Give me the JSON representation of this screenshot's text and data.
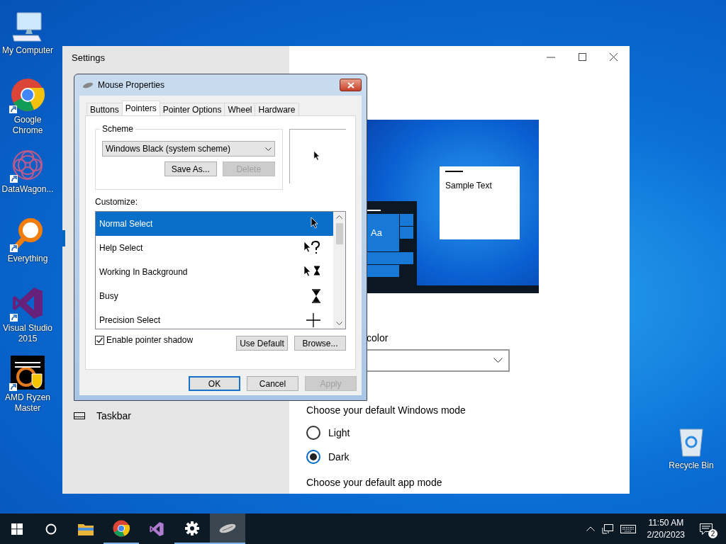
{
  "desktop_icons": [
    {
      "label": "My Computer",
      "kind": "computer",
      "shortcut": false
    },
    {
      "label": "Google Chrome",
      "kind": "chrome",
      "shortcut": true
    },
    {
      "label": "DataWagon...",
      "kind": "datawagon",
      "shortcut": true
    },
    {
      "label": "Everything",
      "kind": "everything",
      "shortcut": true
    },
    {
      "label": "Visual Studio 2015",
      "kind": "visualstudio",
      "shortcut": true
    },
    {
      "label": "AMD Ryzen Master",
      "kind": "ryzen",
      "shortcut": true
    }
  ],
  "recycle_bin": {
    "label": "Recycle Bin"
  },
  "settings": {
    "title": "Settings",
    "nav_items": [
      {
        "label": "Taskbar",
        "selected": false
      }
    ],
    "preview": {
      "tile_text": "Aa",
      "sample_text": "Sample Text"
    },
    "color_label": "color",
    "windows_mode": {
      "heading": "Choose your default Windows mode",
      "options": [
        {
          "label": "Light",
          "selected": false
        },
        {
          "label": "Dark",
          "selected": true
        }
      ]
    },
    "app_mode_heading": "Choose your default app mode"
  },
  "dialog": {
    "title": "Mouse Properties",
    "tabs": [
      {
        "label": "Buttons",
        "selected": false
      },
      {
        "label": "Pointers",
        "selected": true
      },
      {
        "label": "Pointer Options",
        "selected": false
      },
      {
        "label": "Wheel",
        "selected": false
      },
      {
        "label": "Hardware",
        "selected": false
      }
    ],
    "scheme": {
      "legend": "Scheme",
      "value": "Windows Black (system scheme)",
      "buttons": [
        {
          "label": "Save As...",
          "disabled": false
        },
        {
          "label": "Delete",
          "disabled": true
        }
      ]
    },
    "customize_label": "Customize:",
    "cursors": [
      {
        "name": "Normal Select",
        "kind": "arrow",
        "selected": true
      },
      {
        "name": "Help Select",
        "kind": "help",
        "selected": false
      },
      {
        "name": "Working In Background",
        "kind": "working",
        "selected": false
      },
      {
        "name": "Busy",
        "kind": "busy",
        "selected": false
      },
      {
        "name": "Precision Select",
        "kind": "precision",
        "selected": false
      }
    ],
    "pointer_shadow": {
      "label": "Enable pointer shadow",
      "checked": true
    },
    "list_buttons": [
      "Use Default",
      "Browse..."
    ],
    "footer_buttons": [
      {
        "label": "OK",
        "default": true,
        "disabled": false
      },
      {
        "label": "Cancel",
        "default": false,
        "disabled": false
      },
      {
        "label": "Apply",
        "default": false,
        "disabled": true
      }
    ]
  },
  "taskbar": {
    "apps": [
      {
        "kind": "explorer",
        "running": false,
        "active": false
      },
      {
        "kind": "chrome",
        "running": true,
        "active": false
      },
      {
        "kind": "visualstudio",
        "running": false,
        "active": false
      },
      {
        "kind": "settings",
        "running": true,
        "active": false
      },
      {
        "kind": "mouse",
        "running": true,
        "active": true
      }
    ],
    "time": "11:50 AM",
    "date": "2/20/2023",
    "notification_count": "2"
  }
}
